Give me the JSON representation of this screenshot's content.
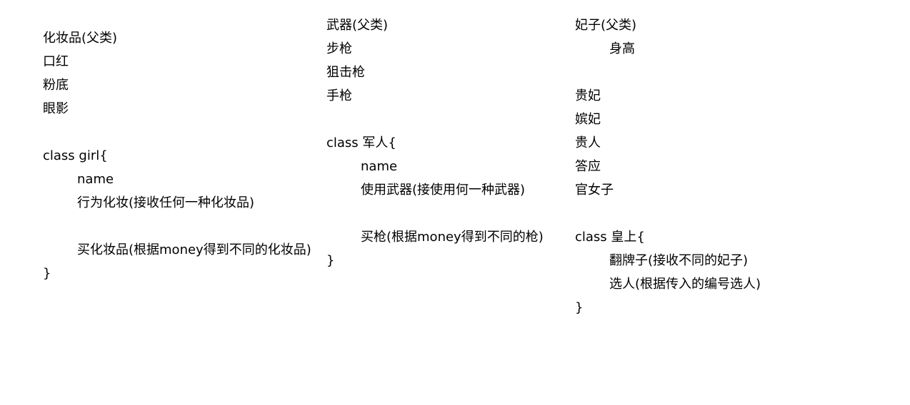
{
  "columns": [
    {
      "name": "cosmetics",
      "lines": [
        {
          "text": "化妆品(父类)",
          "indent": false
        },
        {
          "text": "口红",
          "indent": false
        },
        {
          "text": "粉底",
          "indent": false
        },
        {
          "text": "眼影",
          "indent": false
        },
        {
          "text": "class girl{",
          "indent": false
        },
        {
          "text": "name",
          "indent": true
        },
        {
          "text": "行为化妆(接收任何一种化妆品)",
          "indent": true
        },
        {
          "text": "买化妆品(根据money得到不同的化妆品)",
          "indent": true
        },
        {
          "text": "}",
          "indent": false
        }
      ]
    },
    {
      "name": "weapons",
      "lines": [
        {
          "text": "武器(父类)",
          "indent": false
        },
        {
          "text": "步枪",
          "indent": false
        },
        {
          "text": "狙击枪",
          "indent": false
        },
        {
          "text": "手枪",
          "indent": false
        },
        {
          "text": "class 军人{",
          "indent": false
        },
        {
          "text": "name",
          "indent": true
        },
        {
          "text": "使用武器(接使用何一种武器)",
          "indent": true
        },
        {
          "text": "买枪(根据money得到不同的枪)",
          "indent": true
        },
        {
          "text": "}",
          "indent": false
        }
      ]
    },
    {
      "name": "consorts",
      "lines": [
        {
          "text": "妃子(父类)",
          "indent": false
        },
        {
          "text": "身高",
          "indent": true
        },
        {
          "text": "贵妃",
          "indent": false
        },
        {
          "text": "嫔妃",
          "indent": false
        },
        {
          "text": "贵人",
          "indent": false
        },
        {
          "text": "答应",
          "indent": false
        },
        {
          "text": "官女子",
          "indent": false
        },
        {
          "text": "class 皇上{",
          "indent": false
        },
        {
          "text": "翻牌子(接收不同的妃子)",
          "indent": true
        },
        {
          "text": "选人(根据传入的编号选人)",
          "indent": true
        },
        {
          "text": "}",
          "indent": false
        }
      ]
    }
  ]
}
